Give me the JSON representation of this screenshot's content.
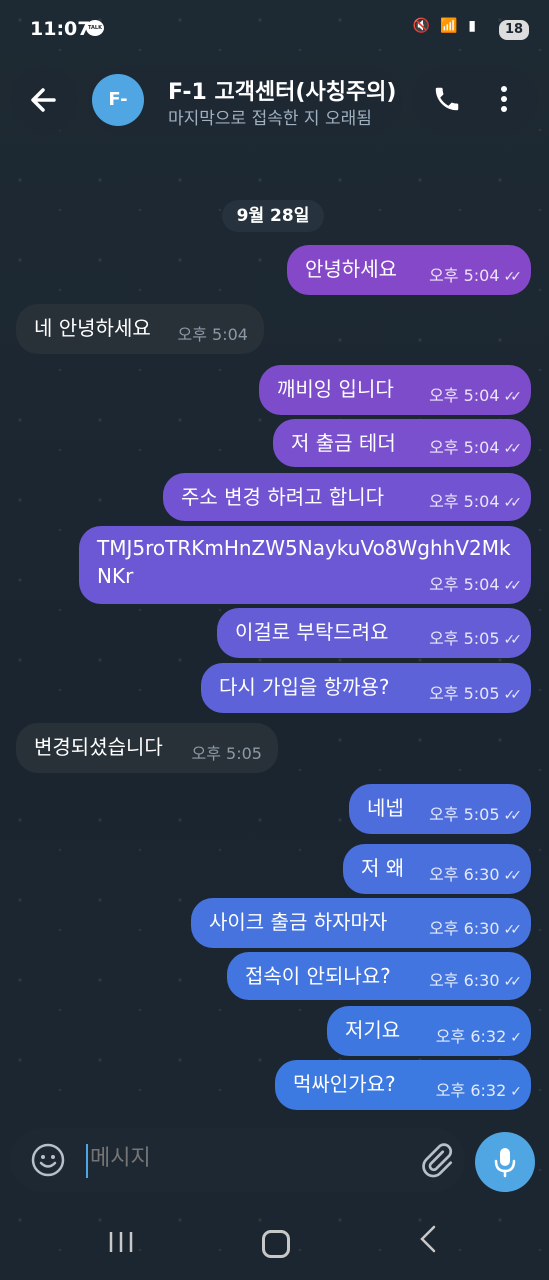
{
  "status_bar": {
    "time": "11:07",
    "talk_icon": "TALK",
    "battery": "18",
    "icons": "mute-icon wifi-icon lte-icon signal-icon",
    "carrier": "Vo LTE"
  },
  "header": {
    "avatar_initials": "F-",
    "title": "F-1 고객센터(사칭주의)",
    "status": "마지막으로 접속한 지 오래됨"
  },
  "date_label": "9월 28일",
  "colors": {
    "outgoing_top": "#8a4fc9",
    "outgoing_bottom": "#3f7ad9",
    "incoming": "#283038",
    "accent": "#4fa6e2"
  },
  "messages": [
    {
      "dir": "out",
      "text": "안녕하세요",
      "time": "오후 5:04",
      "checks": "✓✓"
    },
    {
      "dir": "in",
      "text": "네 안녕하세요",
      "time": "오후 5:04"
    },
    {
      "dir": "out",
      "text": "깨비잉 입니다",
      "time": "오후 5:04",
      "checks": "✓✓"
    },
    {
      "dir": "out",
      "text": "저 출금 테더",
      "time": "오후 5:04",
      "checks": "✓✓"
    },
    {
      "dir": "out",
      "text": "주소 변경 하려고 합니다",
      "time": "오후 5:04",
      "checks": "✓✓"
    },
    {
      "dir": "out",
      "text": "TMJ5roTRKmHnZW5NaykuVo8WghhV2MkNKr",
      "time": "오후 5:04",
      "checks": "✓✓"
    },
    {
      "dir": "out",
      "text": "이걸로 부탁드려요",
      "time": "오후 5:05",
      "checks": "✓✓"
    },
    {
      "dir": "out",
      "text": "다시 가입을 항까용?",
      "time": "오후 5:05",
      "checks": "✓✓"
    },
    {
      "dir": "in",
      "text": "변경되셨습니다",
      "time": "오후 5:05"
    },
    {
      "dir": "out",
      "text": "네넵",
      "time": "오후 5:05",
      "checks": "✓✓"
    },
    {
      "dir": "out",
      "text": "저 왜",
      "time": "오후 6:30",
      "checks": "✓✓"
    },
    {
      "dir": "out",
      "text": "사이크 출금 하자마자",
      "time": "오후 6:30",
      "checks": "✓✓"
    },
    {
      "dir": "out",
      "text": "접속이 안되나요?",
      "time": "오후 6:30",
      "checks": "✓✓"
    },
    {
      "dir": "out",
      "text": "저기요",
      "time": "오후 6:32",
      "checks": "✓"
    },
    {
      "dir": "out",
      "text": "먹싸인가요?",
      "time": "오후 6:32",
      "checks": "✓"
    }
  ],
  "input": {
    "placeholder": "메시지"
  },
  "icons": {
    "back": "back-arrow-icon",
    "phone": "phone-icon",
    "more": "more-vertical-icon",
    "emoji": "emoji-icon",
    "attach": "paperclip-icon",
    "mic": "microphone-icon"
  }
}
